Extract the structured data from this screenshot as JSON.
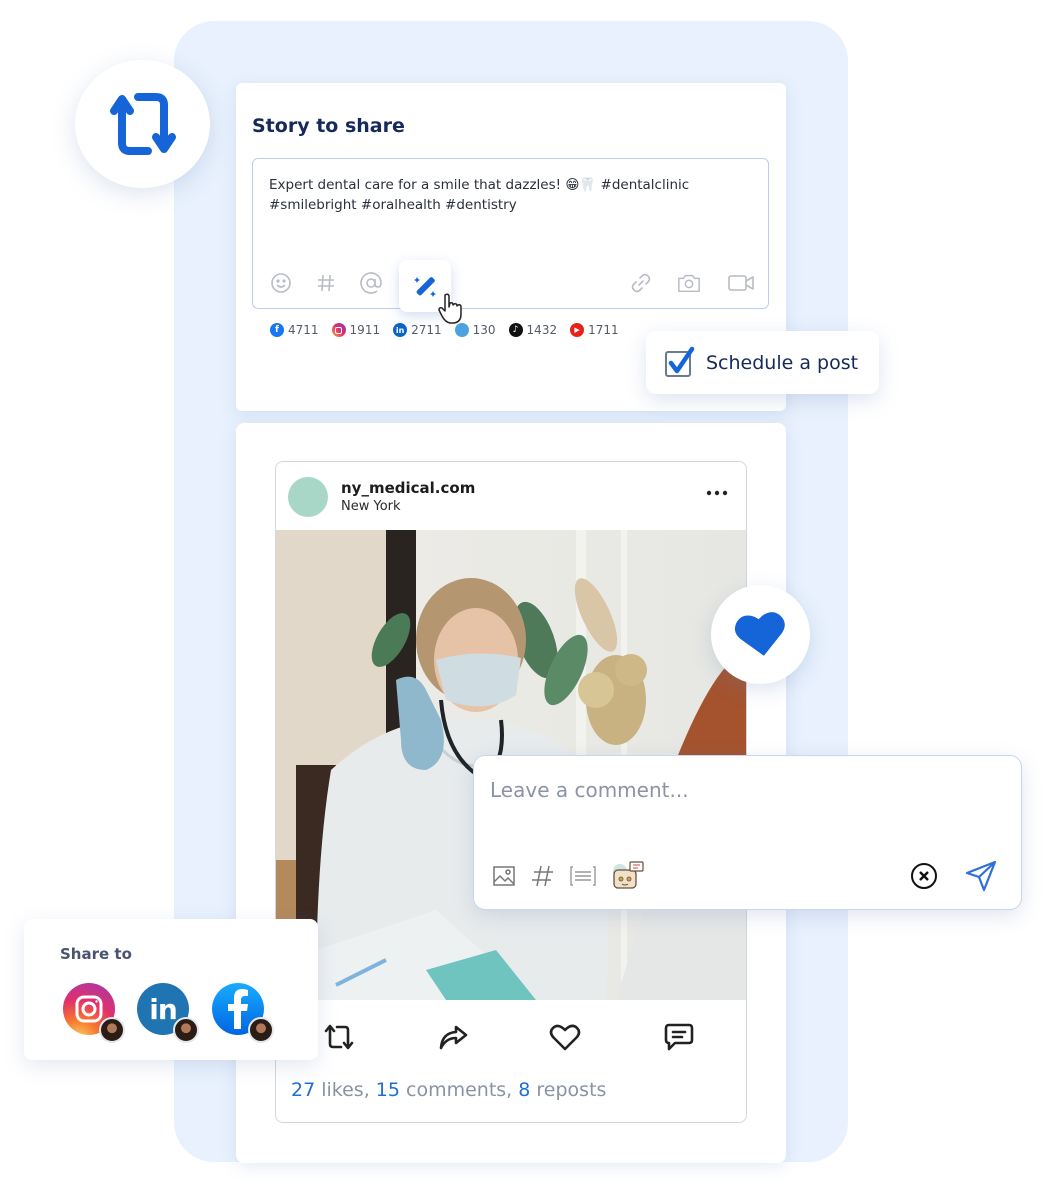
{
  "colors": {
    "accent": "#1565d8",
    "title": "#15295a",
    "backdrop": "#e8f1fd",
    "stat_number": "#1f6fd1",
    "stat_text": "#8a93a3"
  },
  "repost_bubble": {
    "icon": "repost-icon"
  },
  "story": {
    "title": "Story to share",
    "text": "Expert dental care for a smile that dazzles! 😁🦷 #dentalclinic #smilebright #oralhealth #dentistry",
    "toolbar_left": [
      "emoji-icon",
      "hashtag-icon",
      "mention-icon",
      "magic-wand-icon"
    ],
    "toolbar_right": [
      "link-icon",
      "camera-icon",
      "video-icon"
    ],
    "counts": [
      {
        "network": "facebook",
        "icon": "facebook-icon",
        "value": "4711",
        "color": "#1877f2"
      },
      {
        "network": "instagram",
        "icon": "instagram-icon",
        "value": "1911",
        "color": "#e1306c"
      },
      {
        "network": "linkedin",
        "icon": "linkedin-icon",
        "value": "2711",
        "color": "#0a66c2"
      },
      {
        "network": "twitter",
        "icon": "twitter-icon",
        "value": "130",
        "color": "#4aa3df"
      },
      {
        "network": "tiktok",
        "icon": "tiktok-icon",
        "value": "1432",
        "color": "#111111"
      },
      {
        "network": "youtube",
        "icon": "youtube-icon",
        "value": "1711",
        "color": "#e62117"
      }
    ]
  },
  "schedule": {
    "label": "Schedule a post",
    "checked": true
  },
  "post": {
    "username": "ny_medical.com",
    "location": "New York",
    "more_icon": "more-horizontal-icon",
    "actions": [
      "repost-icon",
      "share-icon",
      "like-icon",
      "comment-icon"
    ],
    "likes": "27",
    "likes_label": " likes, ",
    "comments": "15",
    "comments_label": " comments, ",
    "reposts": "8",
    "reposts_label": " reposts"
  },
  "heart_bubble": {
    "icon": "heart-filled-icon"
  },
  "comment": {
    "placeholder": "Leave a comment...",
    "value": "",
    "toolbar": [
      "image-icon",
      "hashtag-icon",
      "template-icon",
      "ai-bot-icon"
    ],
    "clear_icon": "clear-icon",
    "send_icon": "send-icon"
  },
  "share_to": {
    "title": "Share to",
    "networks": [
      {
        "name": "Instagram",
        "icon": "instagram-icon"
      },
      {
        "name": "LinkedIn",
        "icon": "linkedin-icon"
      },
      {
        "name": "Facebook",
        "icon": "facebook-icon"
      }
    ]
  }
}
